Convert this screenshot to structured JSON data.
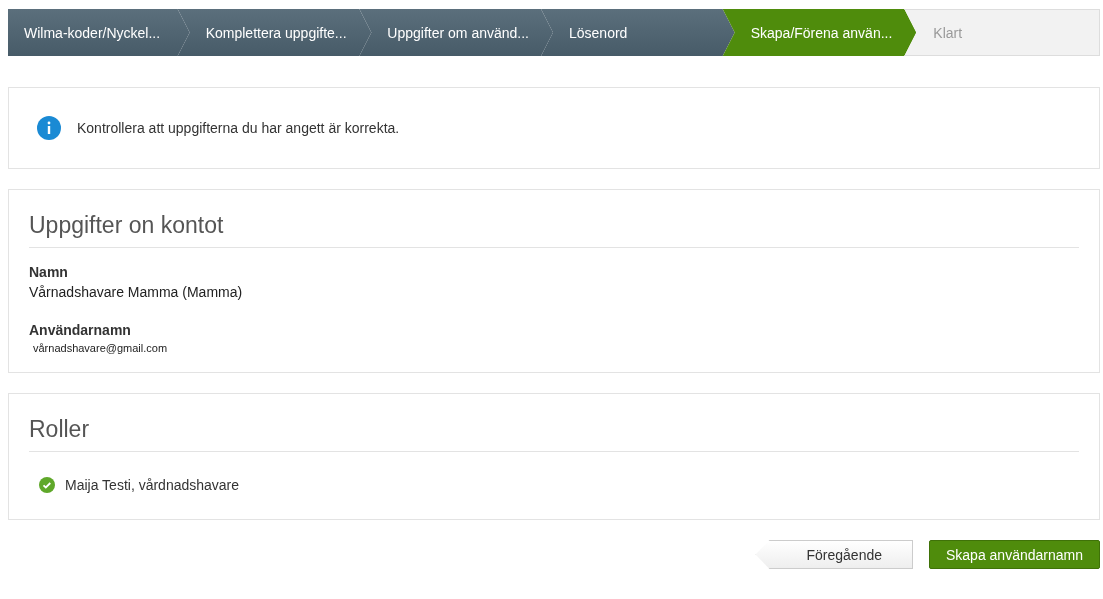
{
  "steps": [
    {
      "label": "Wilma-koder/Nyckel...",
      "completed": true,
      "selected": false
    },
    {
      "label": "Komplettera uppgifte...",
      "completed": true,
      "selected": false
    },
    {
      "label": "Uppgifter om använd...",
      "completed": true,
      "selected": false
    },
    {
      "label": "Lösenord",
      "completed": true,
      "selected": false
    },
    {
      "label": "Skapa/Förena använ...",
      "completed": false,
      "selected": true
    },
    {
      "label": "Klart",
      "completed": false,
      "selected": false
    }
  ],
  "info": {
    "message": "Kontrollera att uppgifterna du har angett är korrekta."
  },
  "account": {
    "title": "Uppgifter on kontot",
    "fields": [
      {
        "label": "Namn",
        "value": "Vårnadshavare Mamma (Mamma)",
        "kind": "text"
      },
      {
        "label": "Användarnamn",
        "value": "vårnadshavare@gmail.com",
        "kind": "pasted"
      }
    ]
  },
  "roles": {
    "title": "Roller",
    "items": [
      {
        "label": "Maija Testi, vårdnadshavare",
        "checked": true
      }
    ]
  },
  "buttons": [
    {
      "label": "Föregående",
      "kind": "back"
    },
    {
      "label": "Skapa användarnamn",
      "kind": "primary"
    }
  ]
}
